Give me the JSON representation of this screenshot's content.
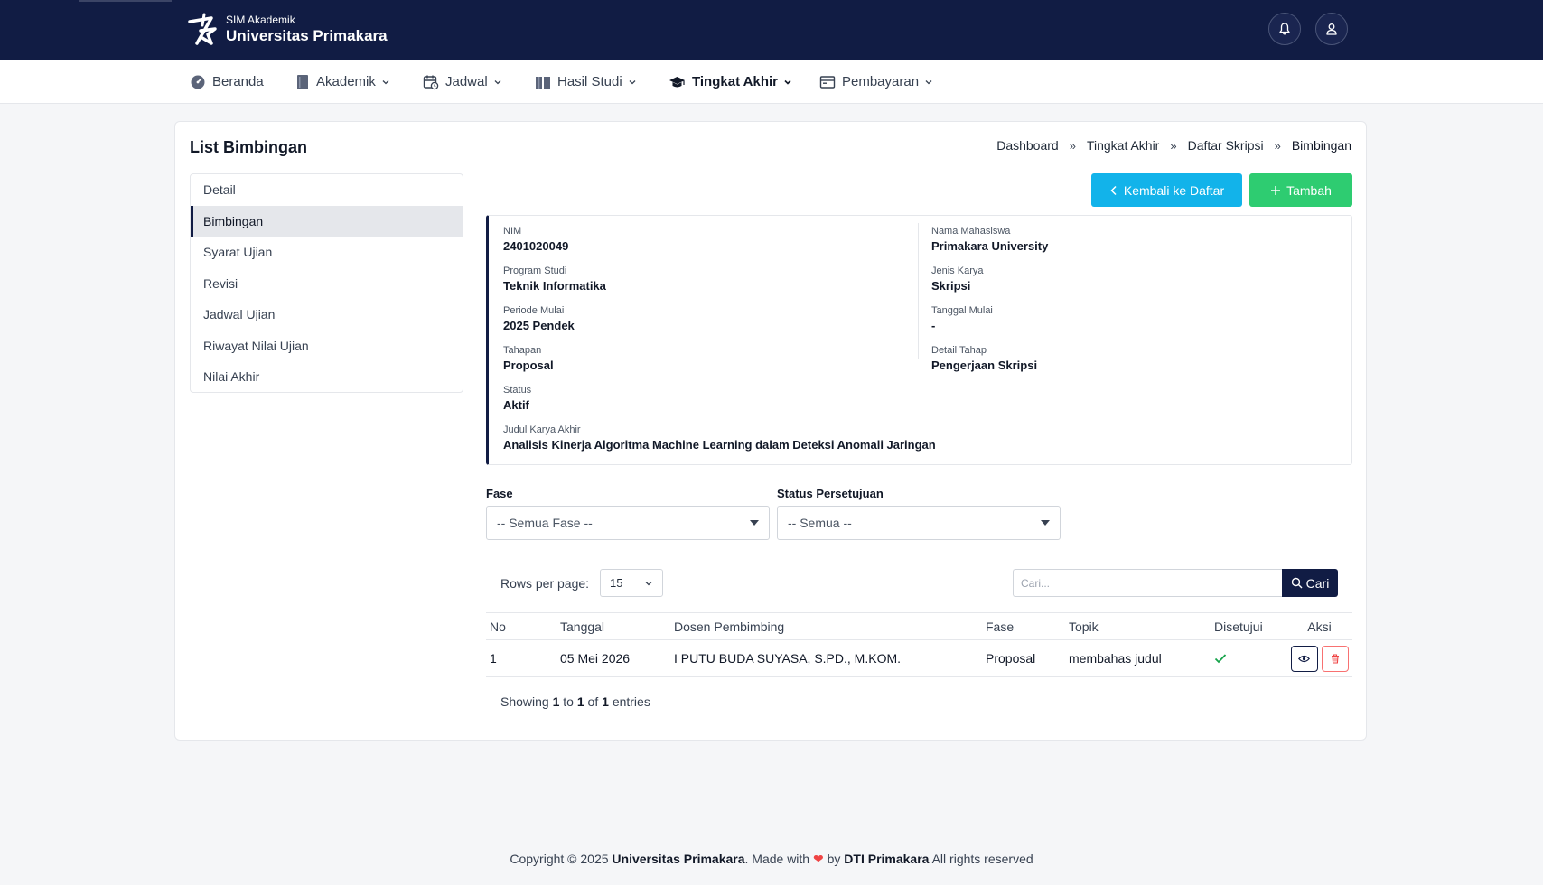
{
  "header": {
    "brand_sub": "SIM Akademik",
    "brand_main": "Universitas Primakara",
    "logo_icon": "star-logo-icon",
    "notification_icon": "bell-icon",
    "profile_icon": "user-icon",
    "bg_color": "#111c44"
  },
  "nav": {
    "items": [
      {
        "label": "Beranda",
        "icon": "dashboard-gauge-icon",
        "has_dropdown": false
      },
      {
        "label": "Akademik",
        "icon": "book-icon",
        "has_dropdown": true
      },
      {
        "label": "Jadwal",
        "icon": "calendar-clock-icon",
        "has_dropdown": true
      },
      {
        "label": "Hasil Studi",
        "icon": "book-open-icon",
        "has_dropdown": true
      },
      {
        "label": "Tingkat Akhir",
        "icon": "graduation-cap-icon",
        "has_dropdown": true,
        "active": true
      },
      {
        "label": "Pembayaran",
        "icon": "wallet-icon",
        "has_dropdown": true
      }
    ]
  },
  "page": {
    "title": "List Bimbingan",
    "breadcrumb": [
      "Dashboard",
      "Tingkat Akhir",
      "Daftar Skripsi",
      "Bimbingan"
    ],
    "breadcrumb_sep": "»"
  },
  "side_menu": {
    "items": [
      "Detail",
      "Bimbingan",
      "Syarat Ujian",
      "Revisi",
      "Jadwal Ujian",
      "Riwayat Nilai Ujian",
      "Nilai Akhir"
    ],
    "active": "Bimbingan"
  },
  "actions": {
    "back_label": "Kembali ke Daftar",
    "add_label": "Tambah",
    "back_color": "#12b3ea",
    "add_color": "#2ecc71"
  },
  "info": {
    "nim": {
      "label": "NIM",
      "value": "2401020049"
    },
    "nama": {
      "label": "Nama Mahasiswa",
      "value": "Primakara University"
    },
    "prodi": {
      "label": "Program Studi",
      "value": "Teknik Informatika"
    },
    "jenis": {
      "label": "Jenis Karya",
      "value": "Skripsi"
    },
    "periode": {
      "label": "Periode Mulai",
      "value": "2025 Pendek"
    },
    "tanggal": {
      "label": "Tanggal Mulai",
      "value": "-"
    },
    "tahapan": {
      "label": "Tahapan",
      "value": "Proposal"
    },
    "detail_tahap": {
      "label": "Detail Tahap",
      "value": "Pengerjaan Skripsi"
    },
    "status": {
      "label": "Status",
      "value": "Aktif"
    },
    "judul": {
      "label": "Judul Karya Akhir",
      "value": "Analisis Kinerja Algoritma Machine Learning dalam Deteksi Anomali Jaringan"
    }
  },
  "filters": {
    "fase_label": "Fase",
    "fase_value": "-- Semua Fase --",
    "status_label": "Status Persetujuan",
    "status_value": "-- Semua --"
  },
  "table_controls": {
    "rows_label": "Rows per page:",
    "rows_value": "15",
    "search_placeholder": "Cari...",
    "search_button": "Cari"
  },
  "table": {
    "headers": [
      "No",
      "Tanggal",
      "Dosen Pembimbing",
      "Fase",
      "Topik",
      "Disetujui",
      "Aksi"
    ],
    "rows": [
      {
        "no": "1",
        "tanggal": "05 Mei 2026",
        "dosen": "I PUTU BUDA SUYASA, S.PD., M.KOM.",
        "fase": "Proposal",
        "topik": "membahas judul",
        "disetujui": "check-icon"
      }
    ]
  },
  "pagination": {
    "showing_prefix": "Showing",
    "from": "1",
    "to_word": "to",
    "to": "1",
    "of_word": "of",
    "total": "1",
    "suffix": "entries"
  },
  "footer": {
    "copyright": "Copyright © 2025",
    "org": "Universitas Primakara",
    "made_with": ". Made with",
    "by": "by",
    "team": "DTI Primakara",
    "rights": "All rights reserved"
  }
}
